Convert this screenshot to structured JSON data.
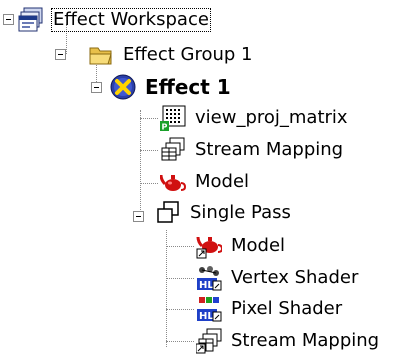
{
  "tree": {
    "items": [
      {
        "label": "Effect Workspace",
        "icon": "workspace-icon",
        "expanded": true,
        "selected": true
      },
      {
        "label": "Effect Group 1",
        "icon": "folder-open-icon",
        "expanded": true
      },
      {
        "label": "Effect 1",
        "icon": "effect-icon",
        "expanded": true,
        "bold": true
      },
      {
        "label": "view_proj_matrix",
        "icon": "matrix-parameter-icon"
      },
      {
        "label": "Stream Mapping",
        "icon": "stream-mapping-icon"
      },
      {
        "label": "Model",
        "icon": "teapot-model-icon"
      },
      {
        "label": "Single Pass",
        "icon": "pass-icon",
        "expanded": true
      },
      {
        "label": "Model",
        "icon": "teapot-model-reference-icon"
      },
      {
        "label": "Vertex Shader",
        "icon": "vertex-shader-hl-icon"
      },
      {
        "label": "Pixel Shader",
        "icon": "pixel-shader-hl-icon"
      },
      {
        "label": "Stream Mapping",
        "icon": "stream-mapping-reference-icon"
      }
    ]
  }
}
